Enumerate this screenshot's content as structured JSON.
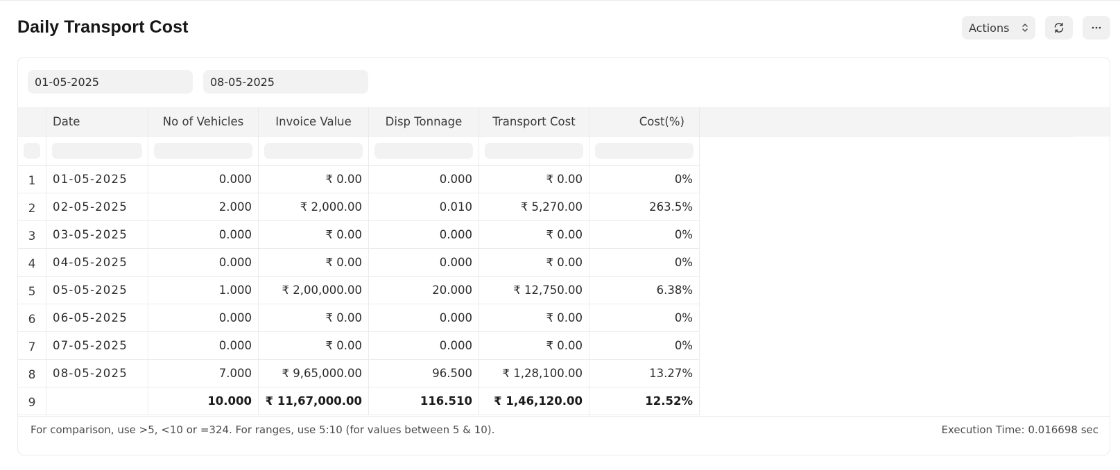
{
  "page": {
    "title": "Daily Transport Cost"
  },
  "toolbar": {
    "actions_label": "Actions"
  },
  "filters": {
    "from_date": "01-05-2025",
    "to_date": "08-05-2025"
  },
  "table": {
    "columns": [
      "Date",
      "No of Vehicles",
      "Invoice Value",
      "Disp Tonnage",
      "Transport Cost",
      "Cost(%)"
    ],
    "rows": [
      {
        "index": "1",
        "date": "01-05-2025",
        "vehicles": "0.000",
        "invoice": "₹ 0.00",
        "tonnage": "0.000",
        "transport": "₹ 0.00",
        "cost_pct": "0%"
      },
      {
        "index": "2",
        "date": "02-05-2025",
        "vehicles": "2.000",
        "invoice": "₹ 2,000.00",
        "tonnage": "0.010",
        "transport": "₹ 5,270.00",
        "cost_pct": "263.5%"
      },
      {
        "index": "3",
        "date": "03-05-2025",
        "vehicles": "0.000",
        "invoice": "₹ 0.00",
        "tonnage": "0.000",
        "transport": "₹ 0.00",
        "cost_pct": "0%"
      },
      {
        "index": "4",
        "date": "04-05-2025",
        "vehicles": "0.000",
        "invoice": "₹ 0.00",
        "tonnage": "0.000",
        "transport": "₹ 0.00",
        "cost_pct": "0%"
      },
      {
        "index": "5",
        "date": "05-05-2025",
        "vehicles": "1.000",
        "invoice": "₹ 2,00,000.00",
        "tonnage": "20.000",
        "transport": "₹ 12,750.00",
        "cost_pct": "6.38%"
      },
      {
        "index": "6",
        "date": "06-05-2025",
        "vehicles": "0.000",
        "invoice": "₹ 0.00",
        "tonnage": "0.000",
        "transport": "₹ 0.00",
        "cost_pct": "0%"
      },
      {
        "index": "7",
        "date": "07-05-2025",
        "vehicles": "0.000",
        "invoice": "₹ 0.00",
        "tonnage": "0.000",
        "transport": "₹ 0.00",
        "cost_pct": "0%"
      },
      {
        "index": "8",
        "date": "08-05-2025",
        "vehicles": "7.000",
        "invoice": "₹ 9,65,000.00",
        "tonnage": "96.500",
        "transport": "₹ 1,28,100.00",
        "cost_pct": "13.27%"
      }
    ],
    "total": {
      "index": "9",
      "date": "",
      "vehicles": "10.000",
      "invoice": "₹ 11,67,000.00",
      "tonnage": "116.510",
      "transport": "₹ 1,46,120.00",
      "cost_pct": "12.52%"
    }
  },
  "footer": {
    "help_text": "For comparison, use >5, <10 or =324. For ranges, use 5:10 (for values between 5 & 10).",
    "execution_time": "Execution Time: 0.016698 sec"
  },
  "icons": {
    "actions": "chevron-up-down-icon",
    "refresh": "refresh-icon",
    "more": "more-horizontal-icon"
  }
}
